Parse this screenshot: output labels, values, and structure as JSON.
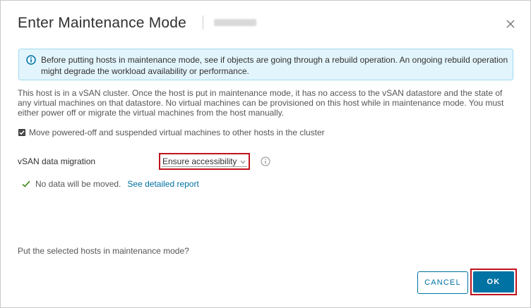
{
  "dialog": {
    "title": "Enter Maintenance Mode",
    "close_icon": "close-icon"
  },
  "alert": {
    "icon": "info-circle-icon",
    "text": "Before putting hosts in maintenance mode, see if objects are going through a rebuild operation. An ongoing rebuild operation might degrade the workload availability or performance."
  },
  "info_text": "This host is in a vSAN cluster. Once the host is put in maintenance mode, it has no access to the vSAN datastore and the state of any virtual machines on that datastore. No virtual machines can be provisioned on this host while in maintenance mode. You must either power off or migrate the virtual machines from the host manually.",
  "move_vms": {
    "checked": true,
    "label": "Move powered-off and suspended virtual machines to other hosts in the cluster"
  },
  "migration": {
    "label": "vSAN data migration",
    "selected": "Ensure accessibility",
    "chevron_icon": "chevron-down-icon",
    "info_icon": "info-circle-icon"
  },
  "status": {
    "icon": "check-icon",
    "text": "No data will be moved.",
    "link": "See detailed report"
  },
  "question": "Put the selected hosts in maintenance mode?",
  "buttons": {
    "cancel": "CANCEL",
    "ok": "OK"
  },
  "colors": {
    "accent": "#0072a3",
    "alert_bg": "#e3f5fc",
    "highlight": "#c0131d",
    "success": "#2f8400"
  }
}
